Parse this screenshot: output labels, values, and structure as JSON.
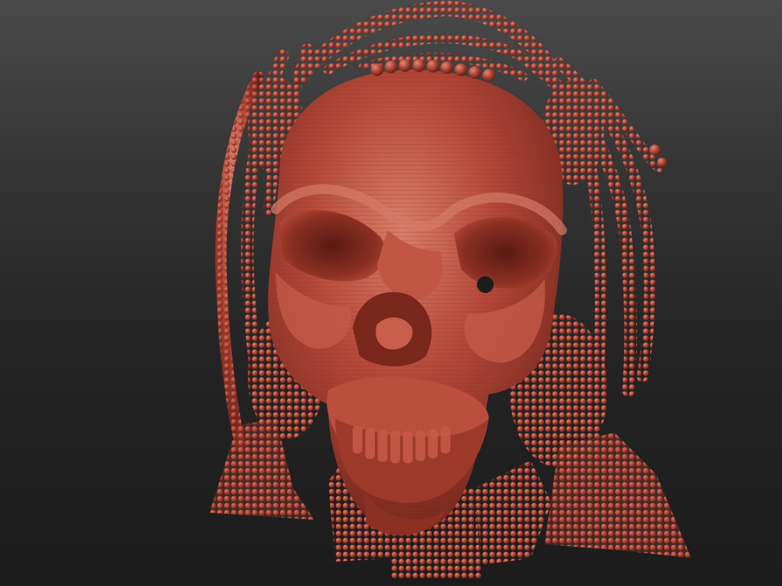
{
  "canvas": {
    "background_top": "#4a4a4a",
    "background_bottom": "#1c1c1c",
    "material_color": "#b84a3a",
    "material_highlight": "#d87a66",
    "material_shadow": "#6a2018",
    "subject": "sculpted-skull-mesh"
  }
}
